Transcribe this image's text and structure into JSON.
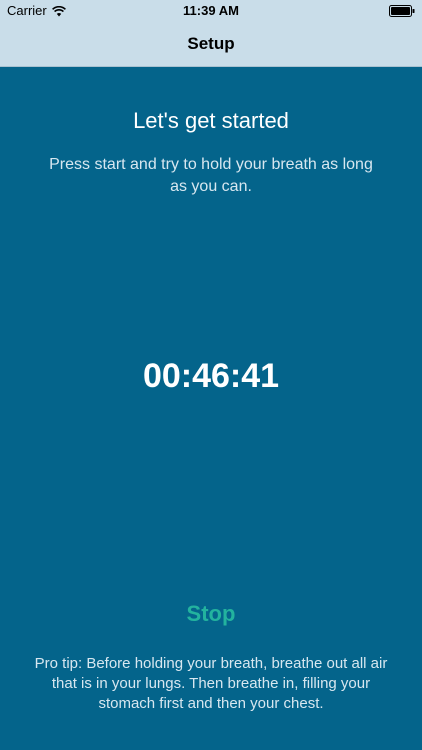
{
  "status_bar": {
    "carrier": "Carrier",
    "time": "11:39 AM",
    "icons": [
      "wifi-icon",
      "battery-icon"
    ]
  },
  "nav": {
    "title": "Setup"
  },
  "main": {
    "heading": "Let's get started",
    "subtitle": "Press start and try to hold your breath as long as you can.",
    "timer": "00:46:41",
    "stop_label": "Stop",
    "pro_tip": "Pro tip: Before holding your breath, breathe out all air that is in your lungs. Then breathe in, filling your stomach first and then your chest."
  },
  "colors": {
    "background": "#04648b",
    "nav_bar": "#c9dde9",
    "accent": "#23b39e"
  }
}
